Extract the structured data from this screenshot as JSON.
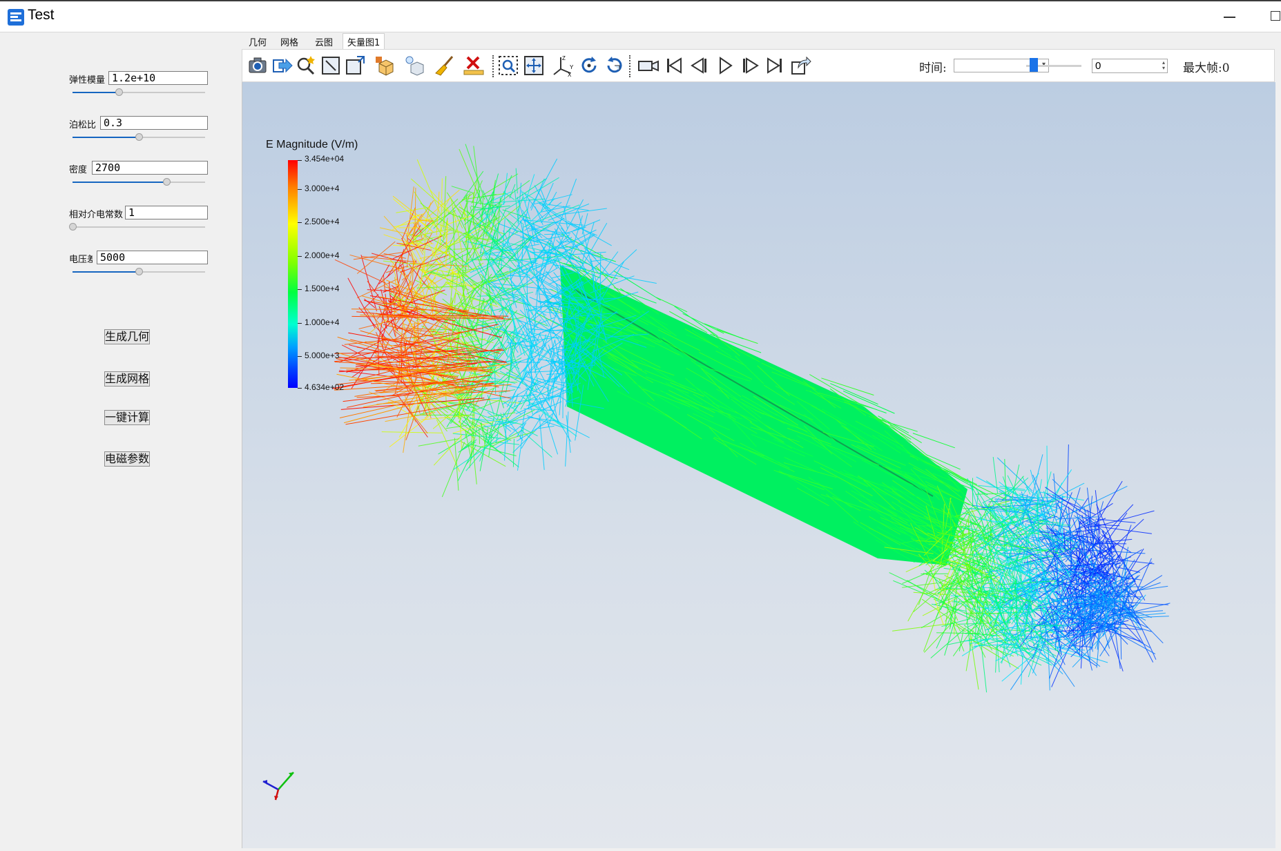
{
  "window": {
    "title": "Test"
  },
  "params": [
    {
      "label": "弹性模量",
      "value": "1.2e+10",
      "slider": 0.35
    },
    {
      "label": "泊松比",
      "value": "0.3",
      "slider": 0.5
    },
    {
      "label": "密度",
      "value": "2700",
      "slider": 0.71
    },
    {
      "label": "相对介电常数",
      "value": "1",
      "slider": 0.0
    },
    {
      "label": "电压差",
      "value": "5000",
      "slider": 0.5
    }
  ],
  "actions": {
    "gen_geometry": "生成几何",
    "gen_mesh": "生成网格",
    "compute": "一键计算",
    "em_params": "电磁参数"
  },
  "tabs": [
    {
      "label": "几何",
      "active": false
    },
    {
      "label": "网格",
      "active": false
    },
    {
      "label": "云图",
      "active": false
    },
    {
      "label": "矢量图1",
      "active": true
    }
  ],
  "toolbar": {
    "time_label": "时间:",
    "time_value": "",
    "frame_value": "0",
    "max_frame": "最大帧:0",
    "time_slider": 0.0
  },
  "legend": {
    "title": "E Magnitude (V/m)",
    "labels": [
      "3.454e+04",
      "3.000e+4",
      "2.500e+4",
      "2.000e+4",
      "1.500e+4",
      "1.000e+4",
      "5.000e+3",
      "4.634e+02"
    ]
  },
  "colors": {
    "accent": "#1565c0",
    "field_high": "#ff0000",
    "field_mid": "#00ff40",
    "field_low": "#0000ff"
  }
}
